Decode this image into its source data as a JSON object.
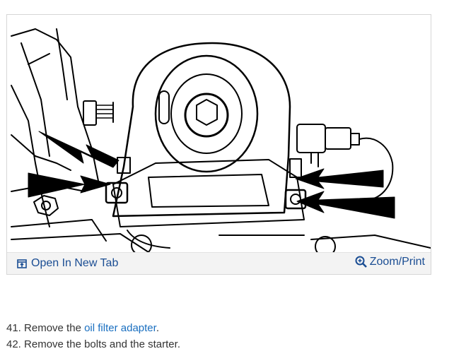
{
  "figure": {
    "image": "engine-oil-filter-adapter-diagram",
    "open_tab_label": "Open In New Tab",
    "open_tab_icon": "open-new-tab-icon",
    "zoom_label": "Zoom/Print",
    "zoom_icon": "magnifier-plus-icon",
    "link_color": "#1a4d93"
  },
  "steps": [
    {
      "number": "41.",
      "prefix": "Remove the ",
      "link": "oil filter adapter",
      "suffix": "."
    },
    {
      "number": "42.",
      "prefix": "Remove the bolts and the starter.",
      "link": "",
      "suffix": ""
    }
  ]
}
